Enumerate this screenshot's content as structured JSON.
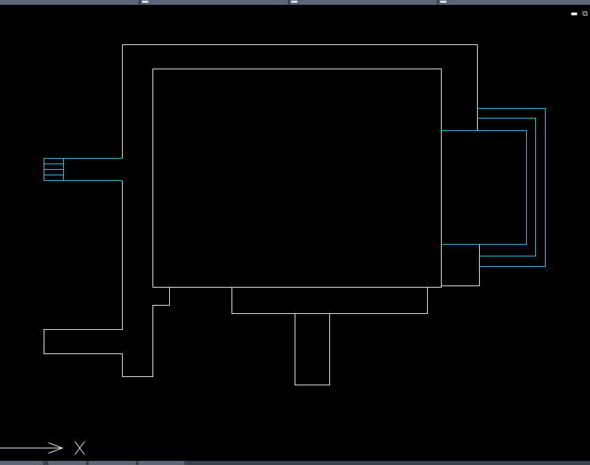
{
  "viewport": {
    "background": "#000000",
    "line_color": "#ffffff",
    "accent_color": "#33d5e8"
  },
  "window_controls": {
    "minimize_icon": "minimize-icon",
    "restore_icon": "restore-icon"
  },
  "ucs": {
    "x_label": "X"
  }
}
